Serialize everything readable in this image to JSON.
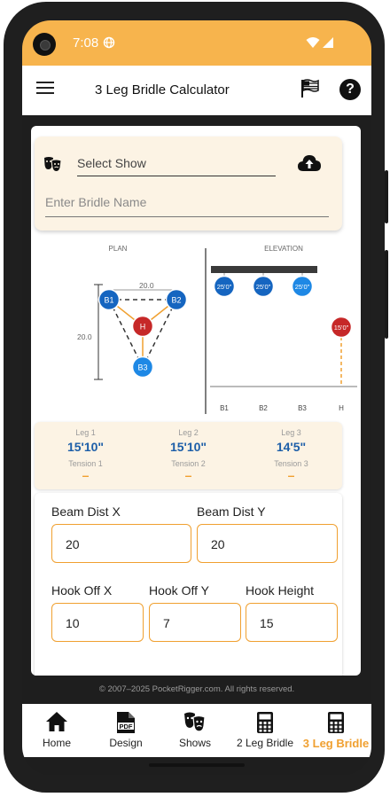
{
  "status": {
    "time": "7:08"
  },
  "appbar": {
    "title": "3 Leg Bridle Calculator"
  },
  "show_card": {
    "select_show": "Select Show",
    "bridle_name_placeholder": "Enter Bridle Name"
  },
  "diagram": {
    "plan_label": "PLAN",
    "elevation_label": "ELEVATION",
    "beam_x_dim": "20.0",
    "beam_y_dim": "20.0",
    "points": {
      "b1": "B1",
      "b2": "B2",
      "b3": "B3",
      "h": "H"
    },
    "elev_b_heights": [
      "25'0\"",
      "25'0\"",
      "25'0\""
    ],
    "elev_h_height": "15'0\"",
    "elev_axis": [
      "B1",
      "B2",
      "B3",
      "H"
    ]
  },
  "legs": [
    {
      "label": "Leg 1",
      "value": "15'10\"",
      "tension_label": "Tension 1",
      "tension_value": "–"
    },
    {
      "label": "Leg 2",
      "value": "15'10\"",
      "tension_label": "Tension 2",
      "tension_value": "–"
    },
    {
      "label": "Leg 3",
      "value": "14'5\"",
      "tension_label": "Tension 3",
      "tension_value": "–"
    }
  ],
  "inputs": {
    "beam_dist_x": {
      "label": "Beam Dist X",
      "value": "20"
    },
    "beam_dist_y": {
      "label": "Beam Dist Y",
      "value": "20"
    },
    "hook_off_x": {
      "label": "Hook Off X",
      "value": "10"
    },
    "hook_off_y": {
      "label": "Hook Off Y",
      "value": "7"
    },
    "hook_height": {
      "label": "Hook Height",
      "value": "15"
    }
  },
  "footer": {
    "copyright": "© 2007–2025 PocketRigger.com. All rights reserved."
  },
  "nav": [
    {
      "label": "Home",
      "icon": "home-icon"
    },
    {
      "label": "Design",
      "icon": "pdf-icon"
    },
    {
      "label": "Shows",
      "icon": "theater-masks-icon"
    },
    {
      "label": "2 Leg Bridle",
      "icon": "calculator-icon"
    },
    {
      "label": "3 Leg Bridle",
      "icon": "calculator-icon"
    }
  ],
  "colors": {
    "accent": "#f7b44d",
    "active_tab": "#f0a030",
    "beam_point": "#1565c0",
    "hook_point": "#c62828",
    "value_blue": "#1c5ea8",
    "card_bg": "#fcf3e4"
  }
}
